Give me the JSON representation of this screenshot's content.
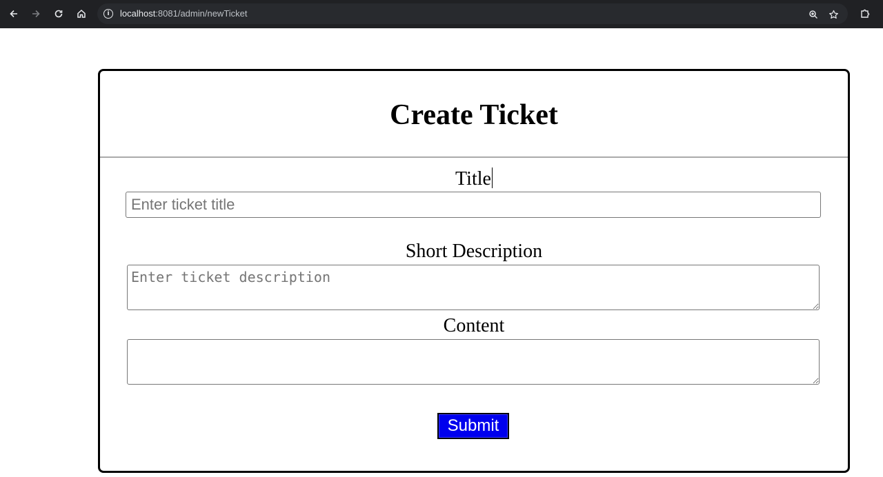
{
  "browser": {
    "url_host": "localhost",
    "url_rest": ":8081/admin/newTicket",
    "icons": {
      "back": "arrow-left-icon",
      "forward": "arrow-right-icon",
      "reload": "reload-icon",
      "home": "home-icon",
      "site_info": "info-icon",
      "zoom": "zoom-icon",
      "bookmark": "star-icon",
      "extensions": "puzzle-icon"
    }
  },
  "form": {
    "heading": "Create Ticket",
    "title_label": "Title",
    "title_placeholder": "Enter ticket title",
    "title_value": "",
    "short_description_label": "Short Description",
    "short_description_placeholder": "Enter ticket description",
    "short_description_value": "",
    "content_label": "Content",
    "content_value": "",
    "submit_label": "Submit"
  },
  "colors": {
    "chrome_bg": "#202124",
    "submit_bg": "#0000ee",
    "submit_text": "#ffffff",
    "card_border": "#000000"
  }
}
